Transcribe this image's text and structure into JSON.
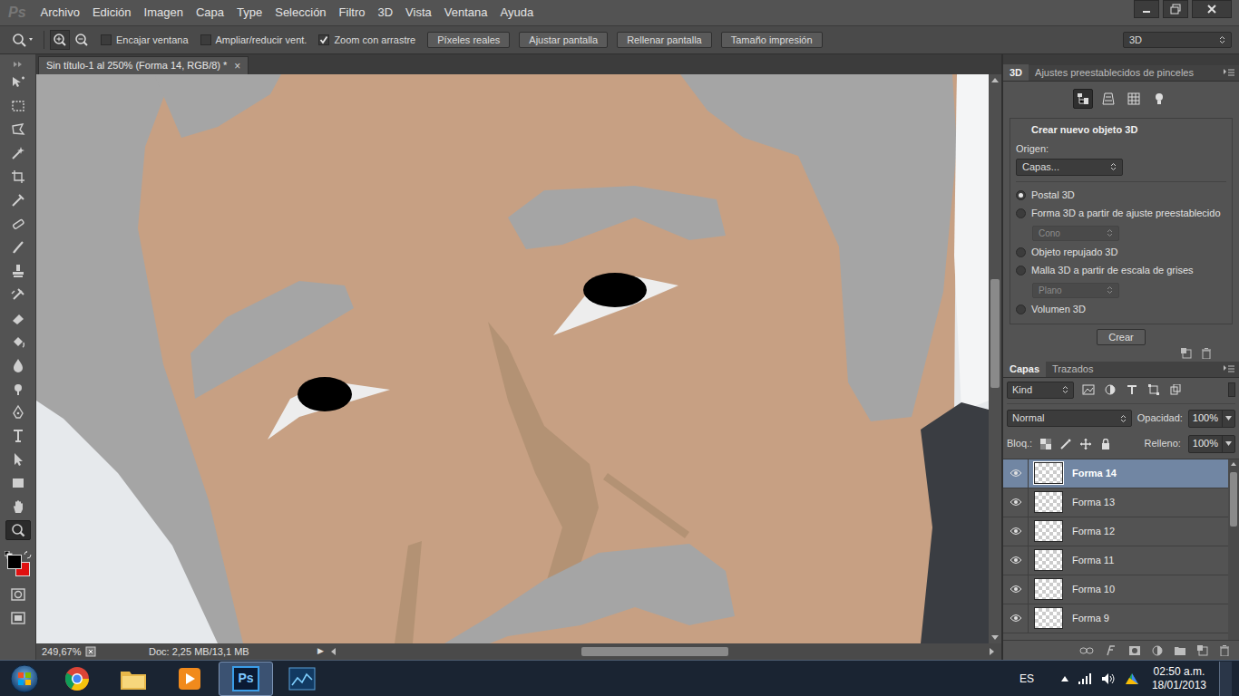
{
  "app": {
    "logo": "Ps"
  },
  "menu": [
    "Archivo",
    "Edición",
    "Imagen",
    "Capa",
    "Type",
    "Selección",
    "Filtro",
    "3D",
    "Vista",
    "Ventana",
    "Ayuda"
  ],
  "options_bar": {
    "checkboxes": [
      {
        "label": "Encajar ventana",
        "checked": false
      },
      {
        "label": "Ampliar/reducir vent.",
        "checked": false
      },
      {
        "label": "Zoom con arrastre",
        "checked": true
      }
    ],
    "buttons": [
      "Píxeles reales",
      "Ajustar pantalla",
      "Rellenar pantalla",
      "Tamaño impresión"
    ],
    "workspace": "3D"
  },
  "document": {
    "tab_title": "Sin título-1 al 250% (Forma 14, RGB/8) *",
    "close": "×",
    "zoom": "249,67%",
    "doc_info": "Doc: 2,25 MB/13,1 MB",
    "status_arrow": "▶"
  },
  "tools": [
    {
      "selected": false
    },
    {
      "selected": false
    },
    {
      "selected": false
    },
    {
      "selected": false
    },
    {
      "selected": false
    },
    {
      "selected": false
    },
    {
      "selected": false
    },
    {
      "selected": false
    },
    {
      "selected": false
    },
    {
      "selected": false
    },
    {
      "selected": false
    },
    {
      "selected": false
    },
    {
      "selected": false
    },
    {
      "selected": false
    },
    {
      "selected": false
    },
    {
      "selected": false
    },
    {
      "selected": false
    },
    {
      "selected": false
    },
    {
      "selected": false
    },
    {
      "selected": true
    }
  ],
  "colors": {
    "foreground": "#000000",
    "background": "#e01010"
  },
  "panel_3d": {
    "tabs": [
      {
        "label": "3D",
        "selected": true
      },
      {
        "label": "Ajustes preestablecidos de pinceles",
        "selected": false
      }
    ],
    "view_icons": [
      {
        "selected": true
      },
      {
        "selected": false
      },
      {
        "selected": false
      },
      {
        "selected": false
      }
    ],
    "group_title": "Crear nuevo objeto 3D",
    "source_label": "Origen:",
    "source_value": "Capas...",
    "options": [
      {
        "label": "Postal 3D",
        "selected": true
      },
      {
        "label": "Forma 3D a partir de ajuste preestablecido",
        "selected": false,
        "dropdown": {
          "value": "Cono",
          "disabled": true
        }
      },
      {
        "label": "Objeto repujado 3D",
        "selected": false
      },
      {
        "label": "Malla 3D a partir de escala de grises",
        "selected": false,
        "dropdown": {
          "value": "Plano",
          "disabled": true
        }
      },
      {
        "label": "Volumen 3D",
        "selected": false
      }
    ],
    "create_button": "Crear"
  },
  "layers_panel": {
    "tabs": [
      {
        "label": "Capas",
        "selected": true
      },
      {
        "label": "Trazados",
        "selected": false
      }
    ],
    "filter": "Kind",
    "blend_mode": "Normal",
    "opacity_label": "Opacidad:",
    "opacity": "100%",
    "lock_label": "Bloq.:",
    "fill_label": "Relleno:",
    "fill": "100%",
    "layers": [
      {
        "name": "Forma 14",
        "visible": true,
        "selected": true
      },
      {
        "name": "Forma 13",
        "visible": true,
        "selected": false
      },
      {
        "name": "Forma 12",
        "visible": true,
        "selected": false
      },
      {
        "name": "Forma 11",
        "visible": true,
        "selected": false
      },
      {
        "name": "Forma 10",
        "visible": true,
        "selected": false
      },
      {
        "name": "Forma 9",
        "visible": true,
        "selected": false
      }
    ]
  },
  "taskbar": {
    "apps": [
      {
        "selected": false
      },
      {
        "selected": false
      },
      {
        "selected": false
      },
      {
        "label": "Ps",
        "selected": true
      },
      {
        "selected": false
      }
    ],
    "language": "ES",
    "time": "02:50 a.m.",
    "date": "18/01/2013"
  }
}
